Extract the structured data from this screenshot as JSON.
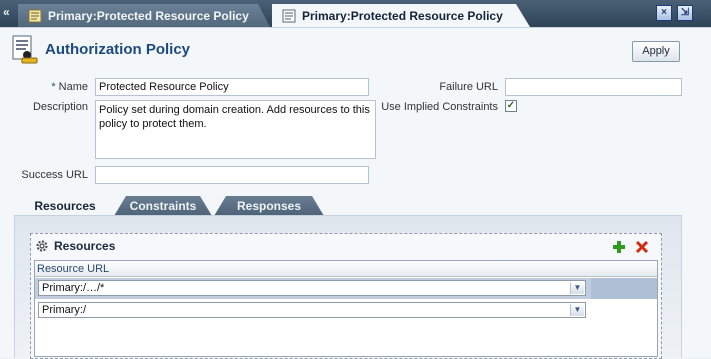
{
  "tabs": [
    {
      "label": "Primary:Protected Resource Policy",
      "active": false
    },
    {
      "label": "Primary:Protected Resource Policy",
      "active": true
    }
  ],
  "window_controls": {
    "collapse": "«",
    "close": "×",
    "restore": "⇲"
  },
  "page": {
    "title": "Authorization Policy",
    "apply_label": "Apply"
  },
  "form": {
    "name_label": "Name",
    "required_marker": "*",
    "name_value": "Protected Resource Policy",
    "description_label": "Description",
    "description_value": "Policy set during domain creation. Add resources to this policy to protect them.",
    "success_url_label": "Success URL",
    "success_url_value": "",
    "failure_url_label": "Failure URL",
    "failure_url_value": "",
    "implied_constraints_label": "Use Implied Constraints",
    "implied_constraints_checked": true,
    "check_glyph": "✓"
  },
  "inner_tabs": [
    {
      "label": "Resources",
      "selected": true
    },
    {
      "label": "Constraints",
      "selected": false
    },
    {
      "label": "Responses",
      "selected": false
    }
  ],
  "resources": {
    "title": "Resources",
    "column_header": "Resource URL",
    "rows": [
      {
        "value": "Primary:/…/*",
        "selected": true
      },
      {
        "value": "Primary:/",
        "selected": false
      }
    ],
    "dropdown_glyph": "▼"
  },
  "colors": {
    "accent": "#1d4a7d",
    "add": "#2e9a1e",
    "delete": "#d42a14",
    "selected_row": "#c2cee0"
  }
}
